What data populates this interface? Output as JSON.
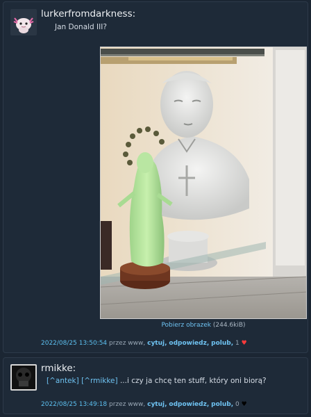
{
  "post1": {
    "author": "lurkerfromdarkness:",
    "content": "Jan Donald III?",
    "image_link": "Pobierz obrazek",
    "image_size": "(244.6kiB)",
    "date": "2022/08/25 13:50:54",
    "via": "przez www,",
    "quote": "cytuj,",
    "reply": "odpowiedz,",
    "like": "polub,",
    "likes": "1",
    "heart_color": "#ff3b3b"
  },
  "post2": {
    "author": "rmikke:",
    "ref1": "[^antek]",
    "ref2": "[^rmikke]",
    "content": "...i czy ja chcę ten stuff, który oni biorą?",
    "date": "2022/08/25 13:49:18",
    "via": "przez www,",
    "quote": "cytuj,",
    "reply": "odpowiedz,",
    "like": "polub,",
    "likes": "0",
    "heart_color": "#000000"
  }
}
